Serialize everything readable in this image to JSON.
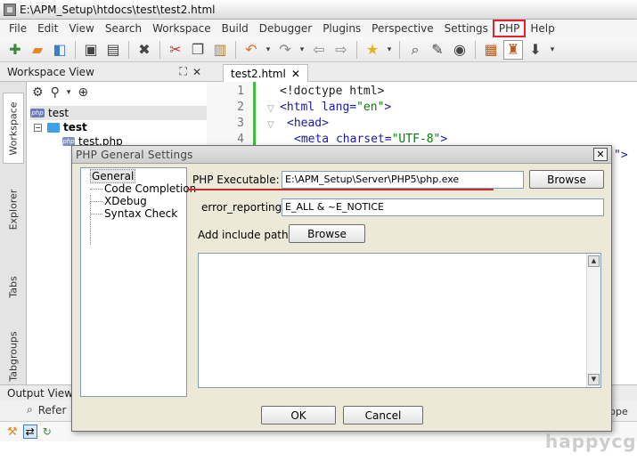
{
  "window": {
    "title": "E:\\APM_Setup\\htdocs\\test\\test2.html"
  },
  "menu": [
    "File",
    "Edit",
    "View",
    "Search",
    "Workspace",
    "Build",
    "Debugger",
    "Plugins",
    "Perspective",
    "Settings",
    "PHP",
    "Help"
  ],
  "workspace": {
    "title": "Workspace View",
    "side_tabs": [
      "Workspace",
      "Explorer",
      "Tabs",
      "Tabgroups"
    ],
    "tree": {
      "workspace": "test",
      "project": "test",
      "file": "test.php"
    }
  },
  "editor": {
    "tab": "test2.html",
    "line_numbers": [
      "1",
      "2",
      "3",
      "4"
    ],
    "lines": {
      "l1": "<!doctype html>",
      "l2_tag": "<html",
      "l2_attr": " lang=",
      "l2_val": "\"en\"",
      "l2_end": ">",
      "l3": "<head>",
      "l4_tag": "<meta",
      "l4_attr": " charset=",
      "l4_val": "\"UTF-8\"",
      "l4_end": ">"
    },
    "fragment": "\">"
  },
  "output": {
    "title": "Output View",
    "tab_left": "Refer",
    "tab_right": "ppe"
  },
  "dialog": {
    "title": "PHP General Settings",
    "nav": [
      "General",
      "Code Completion",
      "XDebug",
      "Syntax Check"
    ],
    "php_executable_label": "PHP Executable:",
    "php_executable_value": "E:\\APM_Setup\\Server\\PHP5\\php.exe",
    "browse_label": "Browse",
    "error_reporting_label": "error_reporting:",
    "error_reporting_value": "E_ALL & ~E_NOTICE",
    "include_path_label": "Add include path:",
    "include_browse_label": "Browse",
    "ok_label": "OK",
    "cancel_label": "Cancel"
  },
  "watermark": "happycgi",
  "colors": {
    "highlight_red": "#e0242a",
    "gutter_green": "#3cbf3c",
    "tag_blue": "#1a1aa6",
    "string_green": "#008000"
  }
}
